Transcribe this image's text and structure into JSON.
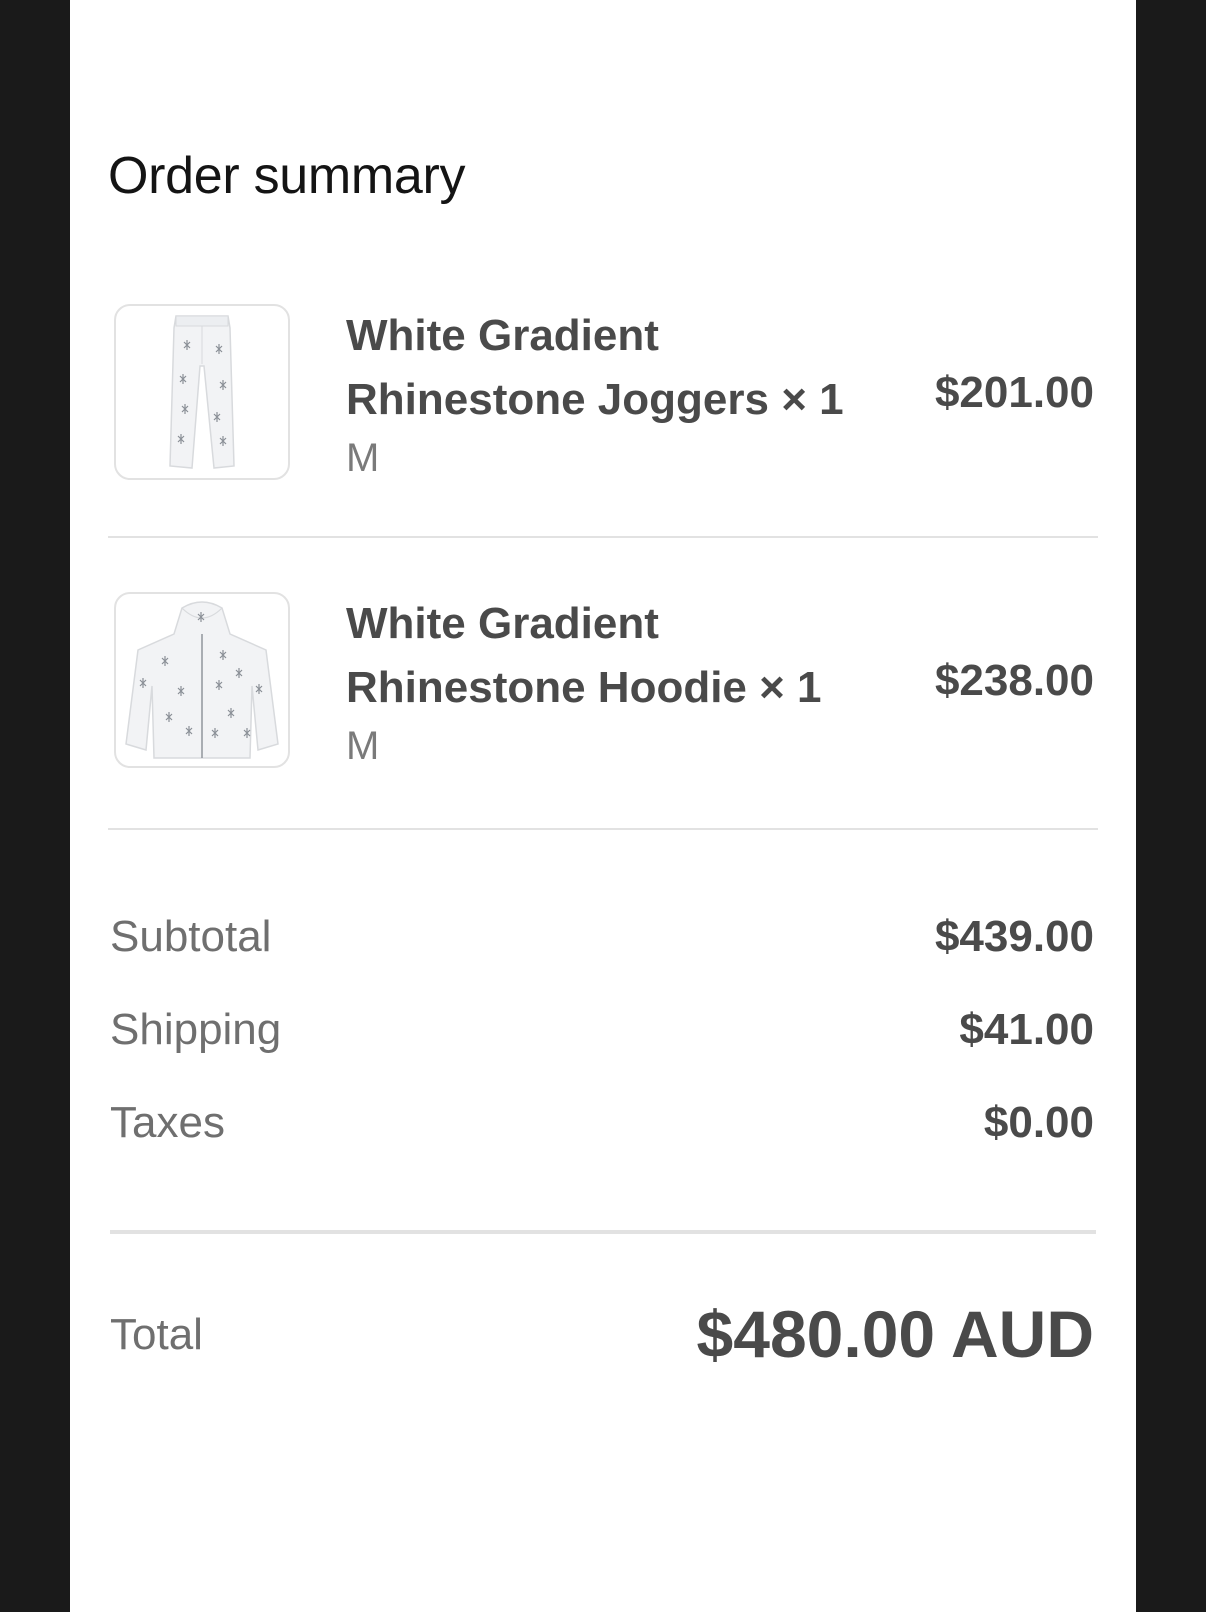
{
  "order_summary": {
    "title": "Order summary",
    "items": [
      {
        "name_line1": "White Gradient",
        "name_line2": "Rhinestone Joggers × 1",
        "variant": "M",
        "price": "$201.00",
        "image_icon": "joggers-thumbnail"
      },
      {
        "name_line1": "White Gradient",
        "name_line2": "Rhinestone Hoodie × 1",
        "variant": "M",
        "price": "$238.00",
        "image_icon": "hoodie-thumbnail"
      }
    ],
    "subtotal_label": "Subtotal",
    "subtotal_value": "$439.00",
    "shipping_label": "Shipping",
    "shipping_value": "$41.00",
    "taxes_label": "Taxes",
    "taxes_value": "$0.00",
    "total_label": "Total",
    "total_value": "$480.00 AUD"
  },
  "colors": {
    "background_outer": "#1a1a1a",
    "panel": "#ffffff",
    "text_dark": "#4a4a4a",
    "text_muted": "#6f6f6f",
    "divider": "#e2e2e2"
  }
}
